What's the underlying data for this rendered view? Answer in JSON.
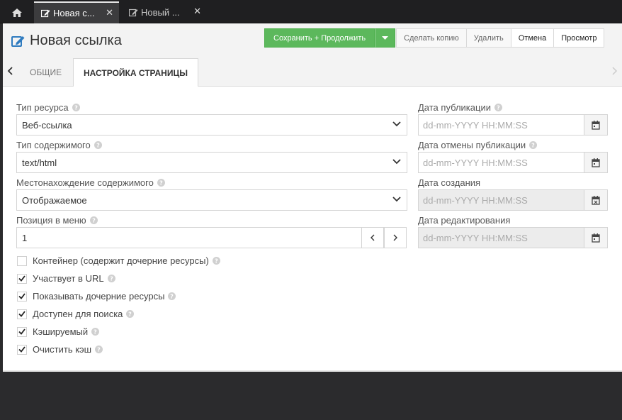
{
  "tabs": [
    {
      "label": "Новая с...",
      "active": true
    },
    {
      "label": "Новый ...",
      "active": false
    }
  ],
  "page": {
    "title": "Новая ссылка"
  },
  "toolbar": {
    "save_continue": "Сохранить + Продолжить",
    "duplicate": "Сделать копию",
    "delete": "Удалить",
    "cancel": "Отмена",
    "view": "Просмотр"
  },
  "section_tabs": [
    {
      "label": "Общие",
      "active": false
    },
    {
      "label": "Настройка страницы",
      "active": true
    }
  ],
  "form": {
    "resource_type": {
      "label": "Тип ресурса",
      "value": "Веб-ссылка"
    },
    "content_type": {
      "label": "Тип содержимого",
      "value": "text/html"
    },
    "content_disposition": {
      "label": "Местонахождение содержимого",
      "value": "Отображаемое"
    },
    "menu_index": {
      "label": "Позиция в меню",
      "value": "1"
    },
    "publish_date": {
      "label": "Дата публикации",
      "placeholder": "dd-mm-YYYY HH:MM:SS"
    },
    "unpublish_date": {
      "label": "Дата отмены публикации",
      "placeholder": "dd-mm-YYYY HH:MM:SS"
    },
    "created_date": {
      "label": "Дата создания",
      "placeholder": "dd-mm-YYYY HH:MM:SS"
    },
    "edited_date": {
      "label": "Дата редактирования",
      "placeholder": "dd-mm-YYYY HH:MM:SS"
    }
  },
  "checkboxes": [
    {
      "label": "Контейнер (содержит дочерние ресурсы)",
      "checked": false
    },
    {
      "label": "Участвует в URL",
      "checked": true
    },
    {
      "label": "Показывать дочерние ресурсы",
      "checked": true
    },
    {
      "label": "Доступен для поиска",
      "checked": true
    },
    {
      "label": "Кэшируемый",
      "checked": true
    },
    {
      "label": "Очистить кэш",
      "checked": true
    }
  ],
  "colors": {
    "accent": "#5cb85c",
    "title_icon": "#2f7bbf"
  },
  "icons": [
    "home-icon",
    "edit-icon",
    "close-icon",
    "caret-down-icon",
    "chevron-left-icon",
    "chevron-right-icon",
    "help-icon",
    "calendar-icon",
    "check-icon"
  ]
}
